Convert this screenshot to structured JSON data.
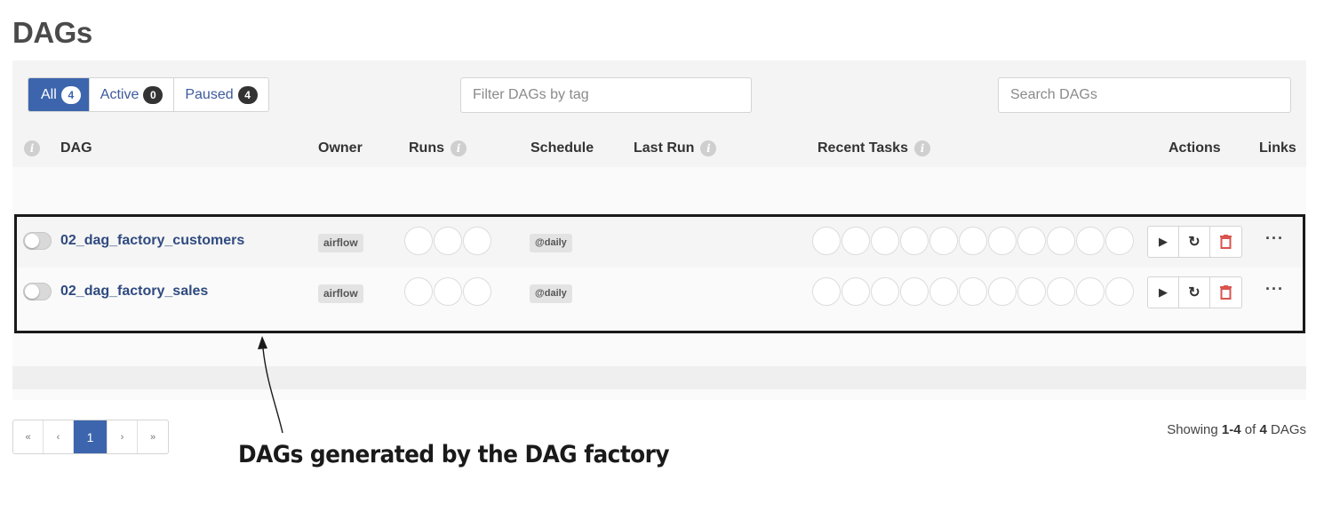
{
  "page": {
    "title": "DAGs"
  },
  "filters": {
    "status_tabs": [
      {
        "label": "All",
        "count": "4",
        "active": true
      },
      {
        "label": "Active",
        "count": "0",
        "active": false
      },
      {
        "label": "Paused",
        "count": "4",
        "active": false
      }
    ],
    "tag_placeholder": "Filter DAGs by tag",
    "search_placeholder": "Search DAGs"
  },
  "table": {
    "headers": {
      "dag": "DAG",
      "owner": "Owner",
      "runs": "Runs",
      "schedule": "Schedule",
      "last_run": "Last Run",
      "recent_tasks": "Recent Tasks",
      "actions": "Actions",
      "links": "Links"
    },
    "info_glyph": "i",
    "rows": [
      {
        "dag_id": "02_dag_factory_customers",
        "owner": "airflow",
        "schedule": "@daily",
        "last_run": "",
        "paused": true
      },
      {
        "dag_id": "02_dag_factory_sales",
        "owner": "airflow",
        "schedule": "@daily",
        "last_run": "",
        "paused": true
      }
    ],
    "actions": {
      "trigger_icon": "▶",
      "refresh_icon": "↻",
      "delete_icon": "trash-icon",
      "more_label": "···"
    }
  },
  "pagination": {
    "first": "«",
    "prev": "‹",
    "current": "1",
    "next": "›",
    "last": "»"
  },
  "summary": {
    "prefix": "Showing ",
    "range": "1-4",
    "of": " of ",
    "total": "4",
    "suffix": " DAGs"
  },
  "annotation": {
    "text": "DAGs generated by the DAG factory"
  },
  "colors": {
    "accent": "#3c65ad",
    "link": "#2f4a7f",
    "delete": "#d9534f"
  }
}
